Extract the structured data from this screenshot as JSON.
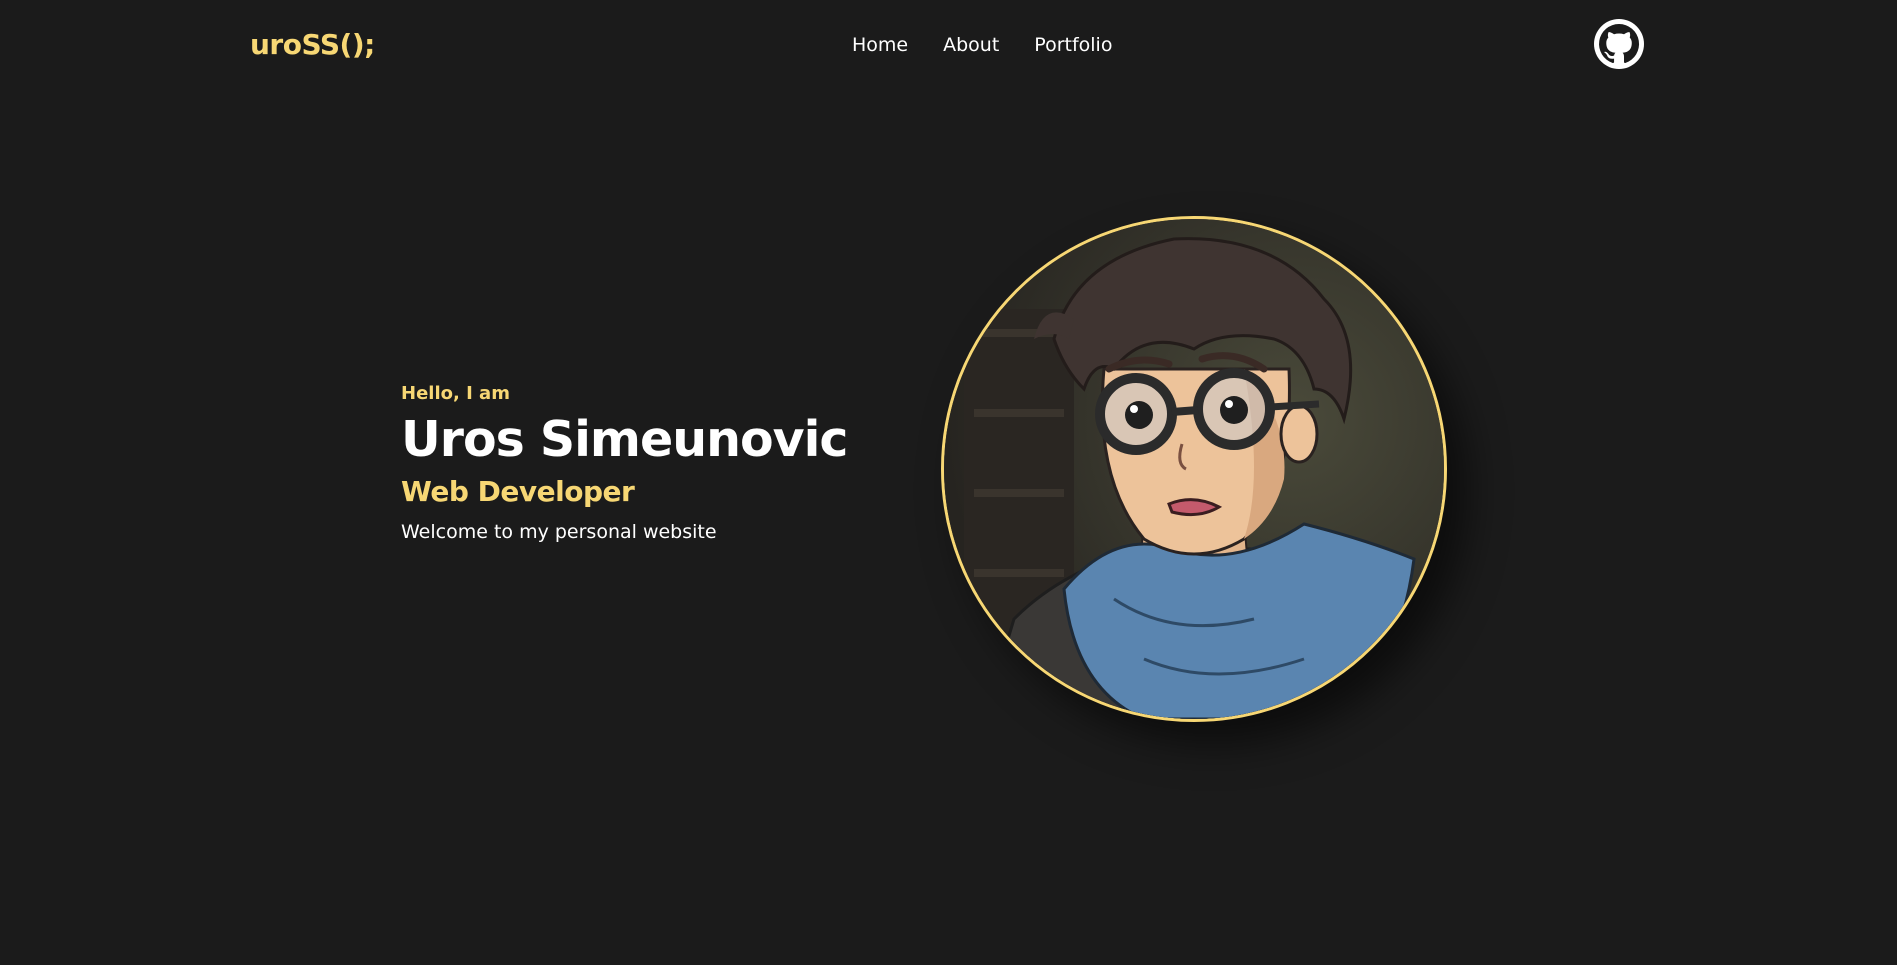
{
  "header": {
    "logo": "uroSS();",
    "nav": [
      {
        "label": "Home"
      },
      {
        "label": "About"
      },
      {
        "label": "Portfolio"
      }
    ],
    "github_icon": "github-icon"
  },
  "hero": {
    "greeting": "Hello, I am",
    "name": "Uros Simeunovic",
    "role": "Web Developer",
    "welcome": "Welcome to my personal website"
  },
  "avatar": {
    "icon": "anime-boy-portrait"
  },
  "colors": {
    "background": "#1b1b1b",
    "accent": "#f7d774",
    "text": "#ffffff"
  }
}
